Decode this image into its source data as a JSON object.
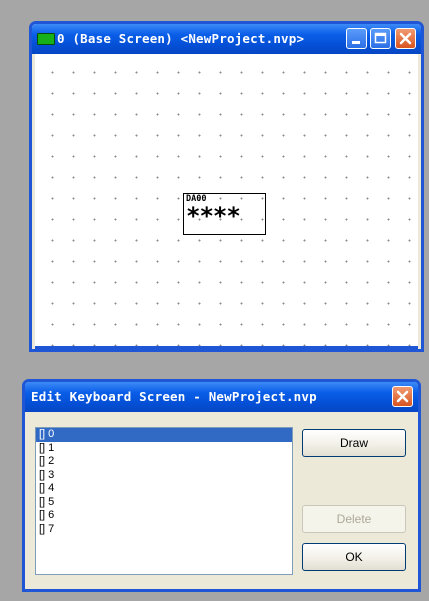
{
  "screen_window": {
    "title": "0 (Base Screen) <NewProject.nvp>",
    "object": {
      "tag": "DA00",
      "value": "****"
    }
  },
  "keyboard_dialog": {
    "title": "Edit Keyboard Screen - NewProject.nvp",
    "list_items": [
      "[] 0",
      "[] 1",
      "[] 2",
      "[] 3",
      "[] 4",
      "[] 5",
      "[] 6",
      "[] 7"
    ],
    "selected_index": 0,
    "buttons": {
      "draw": "Draw",
      "delete": "Delete",
      "ok": "OK"
    }
  },
  "colors": {
    "titlebar": "#0a5ee8",
    "selection": "#316ac5",
    "desktop": "#a6a6a6"
  }
}
